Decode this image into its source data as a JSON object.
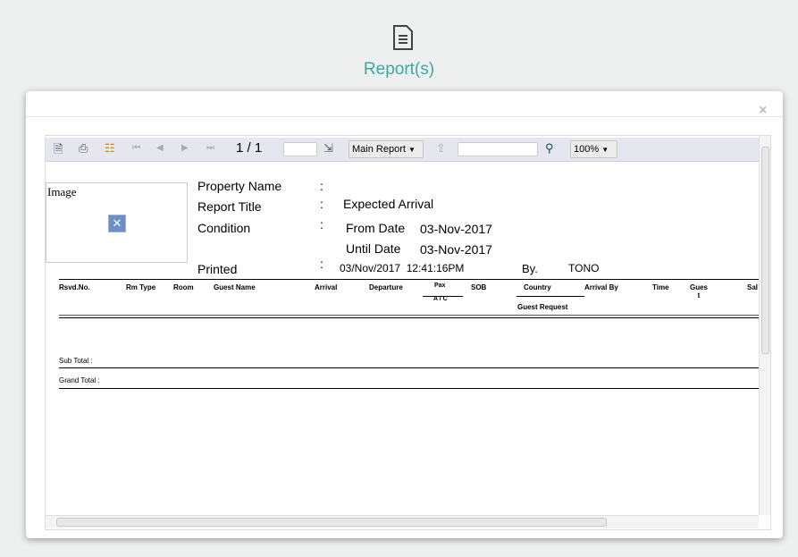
{
  "header": {
    "title": "Report(s)",
    "icon": "document-icon"
  },
  "modal": {
    "close": "×"
  },
  "toolbar": {
    "page_indicator": "1 / 1",
    "report_select": "Main Report",
    "zoom_select": "100%",
    "page_input": "",
    "search_input": ""
  },
  "report": {
    "image_label": "Image",
    "property_name_label": "Property Name",
    "report_title_label": "Report Title",
    "report_title_value": "Expected Arrival",
    "condition_label": "Condition",
    "from_date_label": "From Date",
    "from_date": "03-Nov-2017",
    "until_date_label": "Until Date",
    "until_date": "03-Nov-2017",
    "printed_label": "Printed",
    "printed_value": "03/Nov/2017  12:41:16PM",
    "by_label": "By.",
    "by_value": "TONO",
    "colon": ":",
    "columns": [
      "Rsvd.No.",
      "Rm Type",
      "Room",
      "Guest Name",
      "Arrival",
      "Departure",
      "Pax",
      "SOB",
      "Country",
      "Arrival By",
      "Time",
      "Gues t",
      "Sal"
    ],
    "pax_sub": "A / C",
    "country_sub": "Guest Request",
    "sub_total": "Sub Total :",
    "grand_total": "Grand Total :"
  }
}
